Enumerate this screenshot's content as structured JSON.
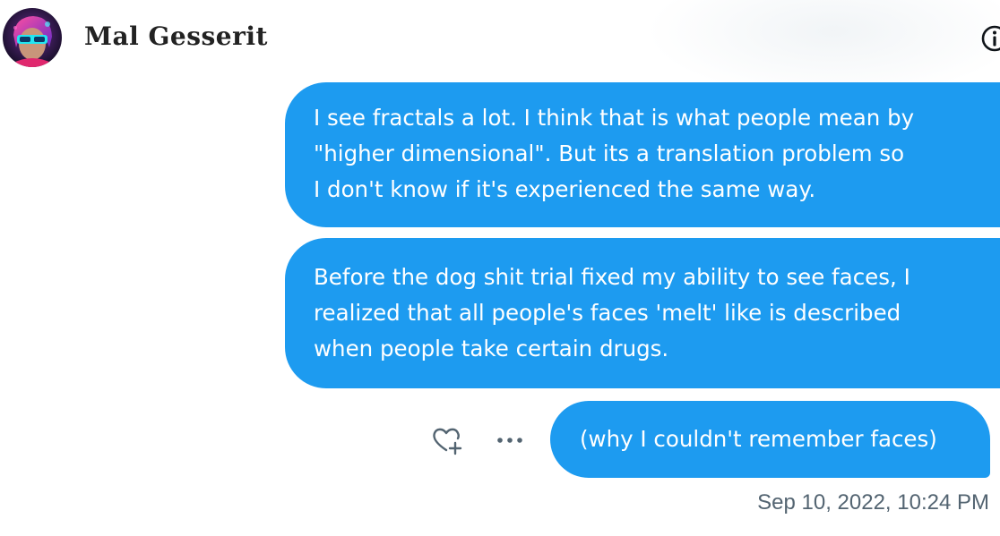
{
  "conversation": {
    "user_name": "Mal Gesserit",
    "avatar_icon": "avatar-image",
    "info_icon": "info-icon"
  },
  "messages": [
    {
      "text": "I see fractals a lot. I think that is what people mean by\n\"higher dimensional\". But its a translation problem so\nI don't know if it's experienced the same way."
    },
    {
      "text": "Before the dog shit trial fixed my ability to see faces, I\nrealized that all people's faces 'melt' like is described\nwhen people take certain drugs."
    },
    {
      "text": "(why I couldn't remember faces)"
    }
  ],
  "message_actions": {
    "reaction_icon": "heart-plus-icon",
    "more_icon": "more-horizontal-icon"
  },
  "timestamp": "Sep 10, 2022, 10:24 PM",
  "colors": {
    "bubble": "#1d9bf0",
    "bubble_text": "#ffffff",
    "meta_text": "#536471",
    "name_text": "#222222"
  }
}
